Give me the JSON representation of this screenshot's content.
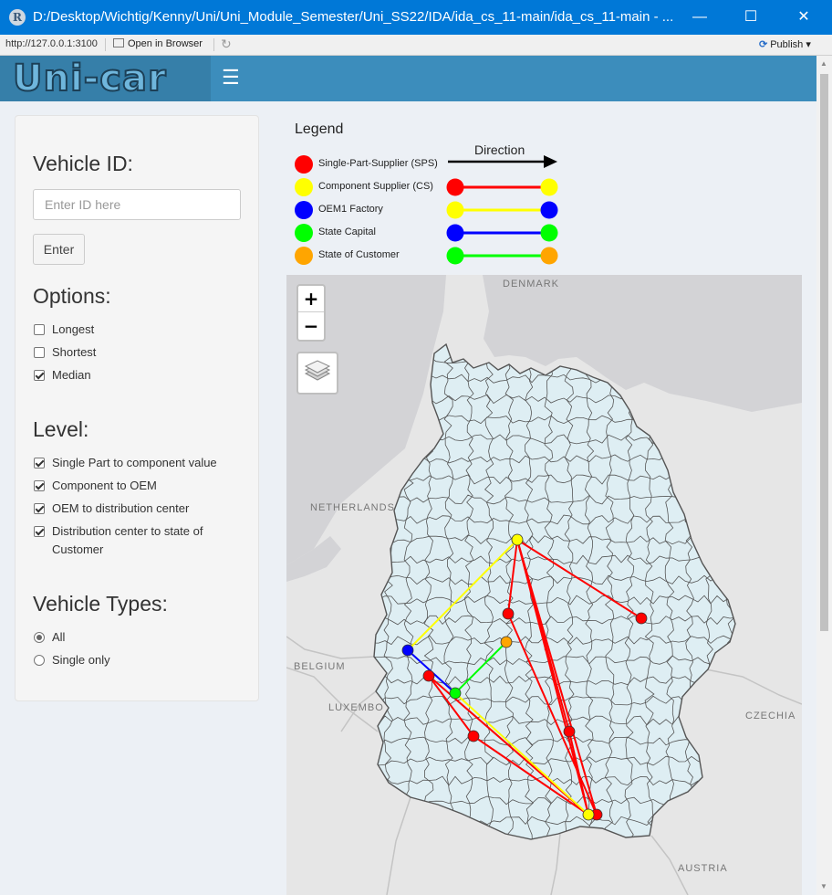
{
  "window": {
    "title": "D:/Desktop/Wichtig/Kenny/Uni/Uni_Module_Semester/Uni_SS22/IDA/ida_cs_11-main/ida_cs_11-main - ...",
    "app_icon": "R",
    "minimize": "—",
    "maximize": "☐",
    "close": "✕"
  },
  "toolbar": {
    "url": "http://127.0.0.1:3100",
    "open_in_browser": "Open in Browser",
    "publish": "Publish"
  },
  "header": {
    "logo_text": "Uni-car",
    "menu_icon": "≡"
  },
  "sidebar": {
    "vehicle_id_title": "Vehicle ID:",
    "id_placeholder": "Enter ID here",
    "enter_label": "Enter",
    "options_title": "Options:",
    "options": [
      {
        "label": "Longest",
        "checked": false
      },
      {
        "label": "Shortest",
        "checked": false
      },
      {
        "label": "Median",
        "checked": true
      }
    ],
    "level_title": "Level:",
    "levels": [
      {
        "label": "Single Part to component value",
        "checked": true
      },
      {
        "label": "Component to OEM",
        "checked": true
      },
      {
        "label": "OEM to distribution center",
        "checked": true
      },
      {
        "label": "Distribution center to state of",
        "label2": "Customer",
        "checked": true
      }
    ],
    "vehicle_types_title": "Vehicle Types:",
    "vehicle_types": [
      {
        "label": "All",
        "selected": true
      },
      {
        "label": "Single only",
        "selected": false
      }
    ]
  },
  "legend": {
    "title": "Legend",
    "direction": "Direction",
    "items": [
      {
        "label": "Single-Part-Supplier (SPS)",
        "color": "#ff0000"
      },
      {
        "label": "Component Supplier (CS)",
        "color": "#ffff00"
      },
      {
        "label": "OEM1 Factory",
        "color": "#0000ff"
      },
      {
        "label": "State Capital",
        "color": "#00ff00"
      },
      {
        "label": "State of Customer",
        "color": "#ffa500"
      }
    ],
    "connections": [
      {
        "from": "#ff0000",
        "to": "#ffff00",
        "line": "#ff0000"
      },
      {
        "from": "#ffff00",
        "to": "#0000ff",
        "line": "#ffff00"
      },
      {
        "from": "#0000ff",
        "to": "#00ff00",
        "line": "#0000ff"
      },
      {
        "from": "#00ff00",
        "to": "#ffa500",
        "line": "#00ff00"
      }
    ]
  },
  "map": {
    "zoom_in": "+",
    "zoom_out": "−",
    "labels": {
      "denmark": "DENMARK",
      "netherlands": "NETHERLANDS",
      "belgium": "BELGIUM",
      "luxembourg": "LUXEMBO",
      "czechia": "CZECHIA",
      "austria": "AUSTRIA"
    },
    "colors": {
      "land": "#deeef3",
      "land_border": "#555555",
      "sea": "#d3d3d6",
      "background": "#e6e6e6"
    }
  }
}
